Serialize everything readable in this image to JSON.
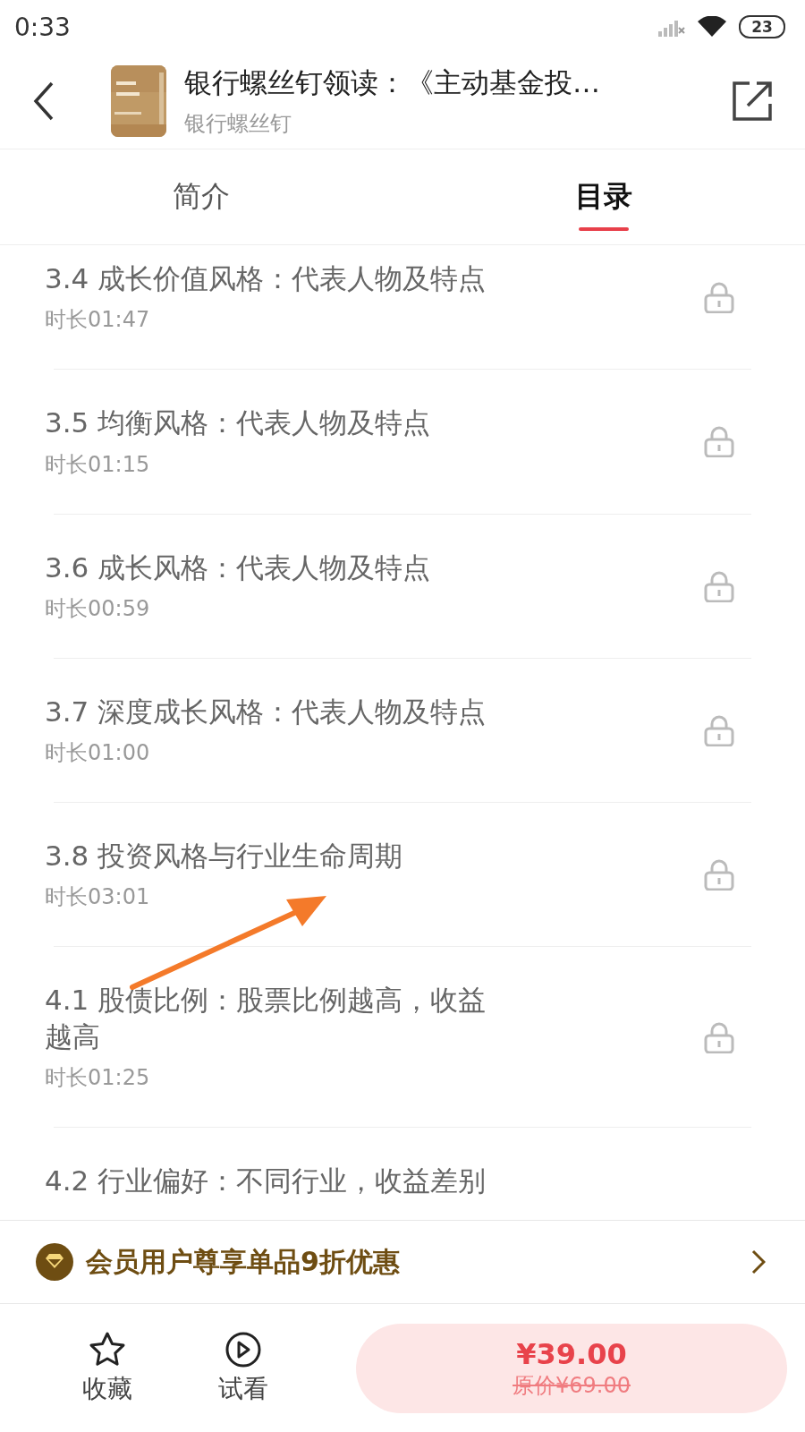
{
  "status_bar": {
    "time": "0:33",
    "battery": "23"
  },
  "header": {
    "title": "银行螺丝钉领读：《主动基金投…",
    "author": "银行螺丝钉"
  },
  "tabs": [
    {
      "label": "简介",
      "selected": false
    },
    {
      "label": "目录",
      "selected": true
    }
  ],
  "lessons": [
    {
      "title": "3.4 成长价值风格：代表人物及特点",
      "duration": "时长01:47",
      "locked": true
    },
    {
      "title": "3.5 均衡风格：代表人物及特点",
      "duration": "时长01:15",
      "locked": true
    },
    {
      "title": "3.6 成长风格：代表人物及特点",
      "duration": "时长00:59",
      "locked": true
    },
    {
      "title": "3.7 深度成长风格：代表人物及特点",
      "duration": "时长01:00",
      "locked": true
    },
    {
      "title": "3.8 投资风格与行业生命周期",
      "duration": "时长03:01",
      "locked": true
    },
    {
      "title": "4.1 股债比例：股票比例越高，收益越高",
      "duration": "时长01:25",
      "locked": true
    },
    {
      "title": "4.2 行业偏好：不同行业，收益差别"
    }
  ],
  "member_banner": {
    "text": "会员用户尊享单品9折优惠"
  },
  "bottom_bar": {
    "actions": [
      {
        "kind": "favorite",
        "label": "收藏"
      },
      {
        "kind": "preview",
        "label": "试看"
      }
    ],
    "price": "¥39.00",
    "original_price": "原价¥69.00"
  }
}
